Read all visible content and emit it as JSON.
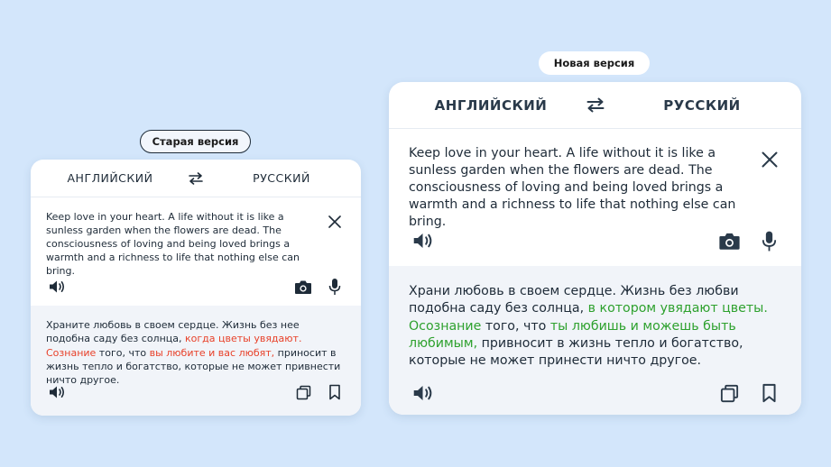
{
  "old_version": {
    "label": "Старая версия",
    "source_lang": "АНГЛИЙСКИЙ",
    "target_lang": "РУССКИЙ",
    "source_text": "Keep love in your heart. A life without it is like a sunless garden when the flowers are dead. The consciousness of loving and being loved brings a warmth and a richness to life that nothing else can bring.",
    "translation": {
      "part1": "Храните любовь в своем сердце. Жизнь без нее подобна саду без солнца, ",
      "hl1": "когда цветы увядают. Сознание",
      "part2": " того, что ",
      "hl2": "вы любите и вас любят,",
      "part3": " приносит в жизнь тепло и богатство, которые не может привнести ничто другое."
    },
    "highlight_color": "#e8412a"
  },
  "new_version": {
    "label": "Новая версия",
    "source_lang": "АНГЛИЙСКИЙ",
    "target_lang": "РУССКИЙ",
    "source_text": "Keep love in your heart. A life without it is like a sunless garden when the flowers are dead. The consciousness of loving and being loved brings a warmth and a richness to life that nothing else can bring.",
    "translation": {
      "part1": "Храни любовь в своем сердце. Жизнь без любви подобна саду без солнца, ",
      "hl1": "в котором увядают цветы. Осознание",
      "part2": " того, что ",
      "hl2": "ты любишь и можешь быть любимым,",
      "part3": " привносит в жизнь тепло и богатство, которые не может принести ничто другое."
    },
    "highlight_color": "#2ea12e"
  },
  "icons": [
    "swap-icon",
    "close-icon",
    "speaker-icon",
    "camera-icon",
    "microphone-icon",
    "copy-icon",
    "bookmark-icon"
  ]
}
